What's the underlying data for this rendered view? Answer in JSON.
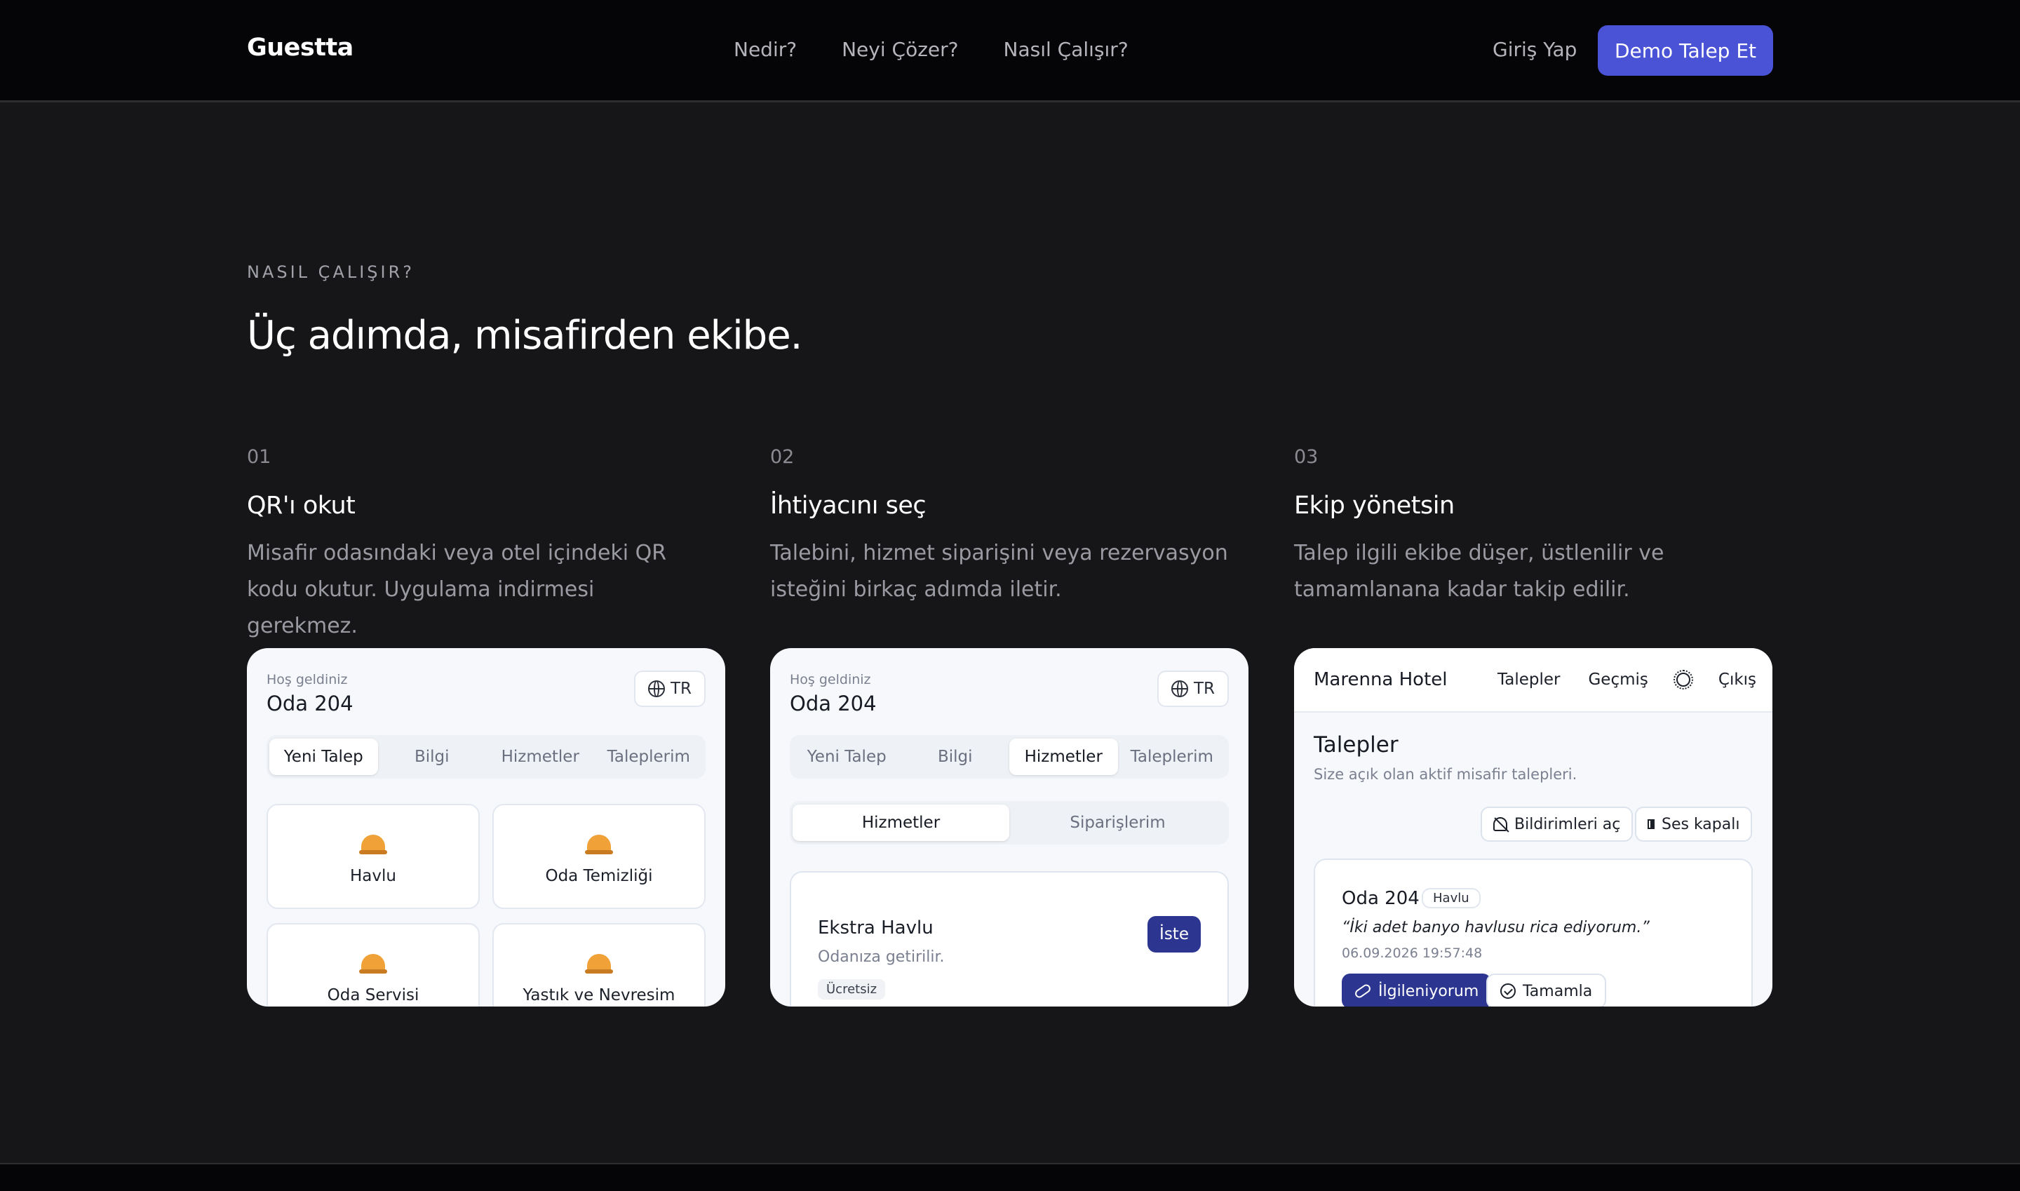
{
  "nav": {
    "brand": "Guestta",
    "links": [
      "Nedir?",
      "Neyi Çözer?",
      "Nasıl Çalışır?"
    ],
    "login": "Giriş Yap",
    "cta": "Demo Talep Et"
  },
  "section": {
    "eyebrow": "NASIL ÇALIŞIR?",
    "headline": "Üç adımda, misafirden ekibe."
  },
  "steps": [
    {
      "num": "01",
      "title": "QR'ı okut",
      "desc": "Misafir odasındaki veya otel içindeki QR kodu okutur. Uygulama indirmesi gerekmez."
    },
    {
      "num": "02",
      "title": "İhtiyacını seç",
      "desc": "Talebini, hizmet siparişini veya rezervasyon isteğini birkaç adımda iletir."
    },
    {
      "num": "03",
      "title": "Ekip yönetsin",
      "desc": "Talep ilgili ekibe düşer, üstlenilir ve tamamlanana kadar takip edilir."
    }
  ],
  "card1": {
    "welcome": "Hoş geldiniz",
    "room": "Oda 204",
    "lang": "TR",
    "tabs": [
      "Yeni Talep",
      "Bilgi",
      "Hizmetler",
      "Taleplerim"
    ],
    "services": [
      "Havlu",
      "Oda Temizliği",
      "Oda Servisi",
      "Yastık ve Nevresim"
    ]
  },
  "card2": {
    "welcome": "Hoş geldiniz",
    "room": "Oda 204",
    "lang": "TR",
    "tabs": [
      "Yeni Talep",
      "Bilgi",
      "Hizmetler",
      "Taleplerim"
    ],
    "subtabs": [
      "Hizmetler",
      "Siparişlerim"
    ],
    "item": {
      "title": "Ekstra Havlu",
      "subtitle": "Odanıza getirilir.",
      "price": "Ücretsiz",
      "action": "İste"
    }
  },
  "card3": {
    "hotel": "Marenna Hotel",
    "nav": [
      "Talepler",
      "Geçmiş",
      "Çıkış"
    ],
    "title": "Talepler",
    "subtitle": "Size açık olan aktif misafir talepleri.",
    "notify_btn": "Bildirimleri aç",
    "sound_btn": "Ses kapalı",
    "request": {
      "room": "Oda 204",
      "category": "Havlu",
      "quote": "“İki adet banyo havlusu rica ediyorum.”",
      "time": "06.09.2026 19:57:48",
      "claim": "İlgileniyorum",
      "complete": "Tamamla"
    }
  },
  "colors": {
    "accent": "#4a52d6",
    "primary_dark": "#2c3590",
    "background": "#161618"
  }
}
